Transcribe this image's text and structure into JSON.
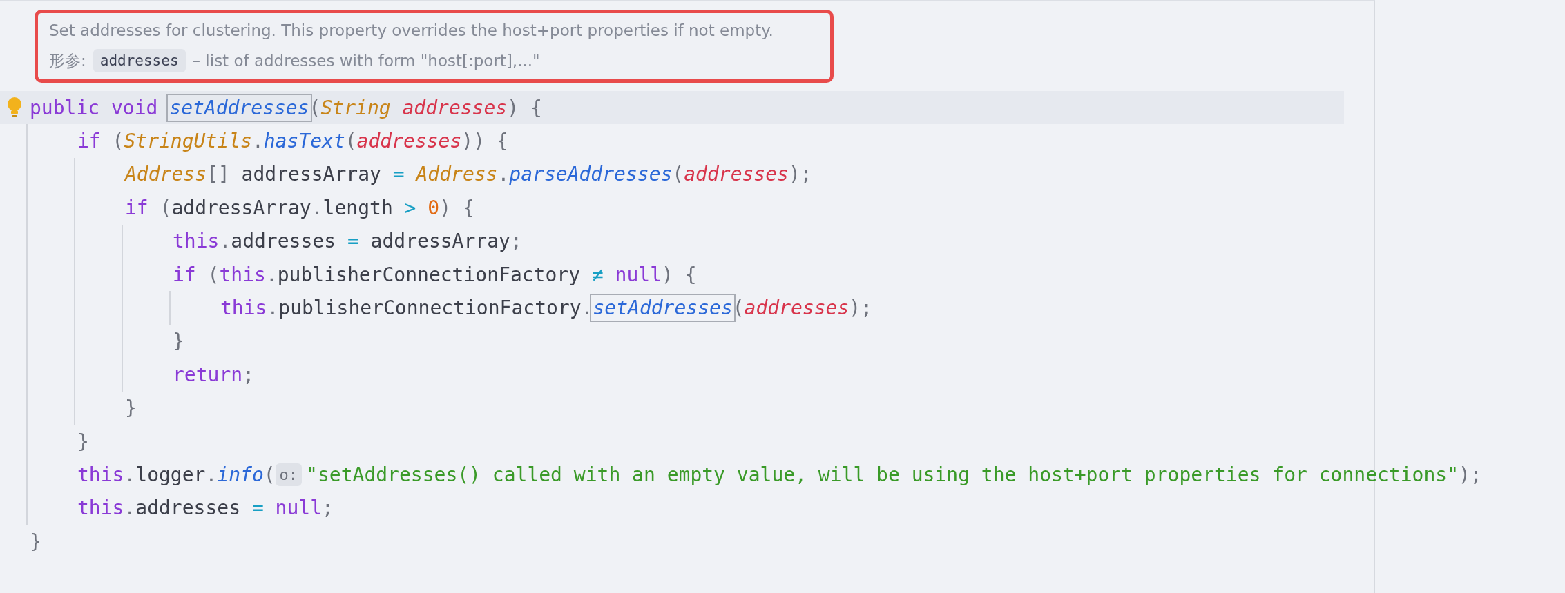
{
  "doc_popup": {
    "description": "Set addresses for clustering. This property overrides the host+port properties if not empty.",
    "param_label": "形参:",
    "param_name": "addresses",
    "param_description": "– list of addresses with form \"host[:port],...\""
  },
  "code": [
    {
      "current": true,
      "tokens": [
        {
          "kind": "keyword",
          "text": "public void "
        },
        {
          "kind": "method",
          "text": "setAddresses",
          "boxed": true
        },
        {
          "kind": "punct",
          "text": "("
        },
        {
          "kind": "type",
          "text": "String "
        },
        {
          "kind": "param",
          "text": "addresses"
        },
        {
          "kind": "punct",
          "text": ") {"
        }
      ],
      "children": [
        {
          "tokens": [
            {
              "kind": "keyword",
              "text": "if "
            },
            {
              "kind": "punct",
              "text": "("
            },
            {
              "kind": "type",
              "text": "StringUtils"
            },
            {
              "kind": "punct",
              "text": "."
            },
            {
              "kind": "method",
              "text": "hasText"
            },
            {
              "kind": "punct",
              "text": "("
            },
            {
              "kind": "param",
              "text": "addresses"
            },
            {
              "kind": "punct",
              "text": ")) {"
            }
          ],
          "children": [
            {
              "tokens": [
                {
                  "kind": "type",
                  "text": "Address"
                },
                {
                  "kind": "punct",
                  "text": "[] "
                },
                {
                  "kind": "plain",
                  "text": "addressArray "
                },
                {
                  "kind": "op",
                  "text": "= "
                },
                {
                  "kind": "type",
                  "text": "Address"
                },
                {
                  "kind": "punct",
                  "text": "."
                },
                {
                  "kind": "method",
                  "text": "parseAddresses"
                },
                {
                  "kind": "punct",
                  "text": "("
                },
                {
                  "kind": "param",
                  "text": "addresses"
                },
                {
                  "kind": "punct",
                  "text": ");"
                }
              ]
            },
            {
              "tokens": [
                {
                  "kind": "keyword",
                  "text": "if "
                },
                {
                  "kind": "punct",
                  "text": "("
                },
                {
                  "kind": "plain",
                  "text": "addressArray"
                },
                {
                  "kind": "punct",
                  "text": "."
                },
                {
                  "kind": "plain",
                  "text": "length "
                },
                {
                  "kind": "op",
                  "text": "> "
                },
                {
                  "kind": "number",
                  "text": "0"
                },
                {
                  "kind": "punct",
                  "text": ") {"
                }
              ],
              "children": [
                {
                  "tokens": [
                    {
                      "kind": "keyword",
                      "text": "this"
                    },
                    {
                      "kind": "punct",
                      "text": "."
                    },
                    {
                      "kind": "plain",
                      "text": "addresses "
                    },
                    {
                      "kind": "op",
                      "text": "= "
                    },
                    {
                      "kind": "plain",
                      "text": "addressArray"
                    },
                    {
                      "kind": "punct",
                      "text": ";"
                    }
                  ]
                },
                {
                  "tokens": [
                    {
                      "kind": "keyword",
                      "text": "if "
                    },
                    {
                      "kind": "punct",
                      "text": "("
                    },
                    {
                      "kind": "keyword",
                      "text": "this"
                    },
                    {
                      "kind": "punct",
                      "text": "."
                    },
                    {
                      "kind": "plain",
                      "text": "publisherConnectionFactory "
                    },
                    {
                      "kind": "op",
                      "text": "≠ "
                    },
                    {
                      "kind": "keyword",
                      "text": "null"
                    },
                    {
                      "kind": "punct",
                      "text": ") {"
                    }
                  ],
                  "children": [
                    {
                      "tokens": [
                        {
                          "kind": "keyword",
                          "text": "this"
                        },
                        {
                          "kind": "punct",
                          "text": "."
                        },
                        {
                          "kind": "plain",
                          "text": "publisherConnectionFactory"
                        },
                        {
                          "kind": "punct",
                          "text": "."
                        },
                        {
                          "kind": "method",
                          "text": "setAddresses",
                          "boxed": true
                        },
                        {
                          "kind": "punct",
                          "text": "("
                        },
                        {
                          "kind": "param",
                          "text": "addresses"
                        },
                        {
                          "kind": "punct",
                          "text": ");"
                        }
                      ]
                    }
                  ],
                  "close": "}"
                },
                {
                  "tokens": [
                    {
                      "kind": "keyword",
                      "text": "return"
                    },
                    {
                      "kind": "punct",
                      "text": ";"
                    }
                  ]
                }
              ],
              "close": "}"
            }
          ],
          "close": "}"
        },
        {
          "tokens": [
            {
              "kind": "keyword",
              "text": "this"
            },
            {
              "kind": "punct",
              "text": "."
            },
            {
              "kind": "plain",
              "text": "logger"
            },
            {
              "kind": "punct",
              "text": "."
            },
            {
              "kind": "method",
              "text": "info"
            },
            {
              "kind": "punct",
              "text": "("
            },
            {
              "kind": "hint",
              "text": "o:"
            },
            {
              "kind": "string",
              "text": "\"setAddresses() called with an empty value, will be using the host+port properties for connections\""
            },
            {
              "kind": "punct",
              "text": ");"
            }
          ]
        },
        {
          "tokens": [
            {
              "kind": "keyword",
              "text": "this"
            },
            {
              "kind": "punct",
              "text": "."
            },
            {
              "kind": "plain",
              "text": "addresses "
            },
            {
              "kind": "op",
              "text": "= "
            },
            {
              "kind": "keyword",
              "text": "null"
            },
            {
              "kind": "punct",
              "text": ";"
            }
          ]
        }
      ],
      "close": "}"
    }
  ]
}
